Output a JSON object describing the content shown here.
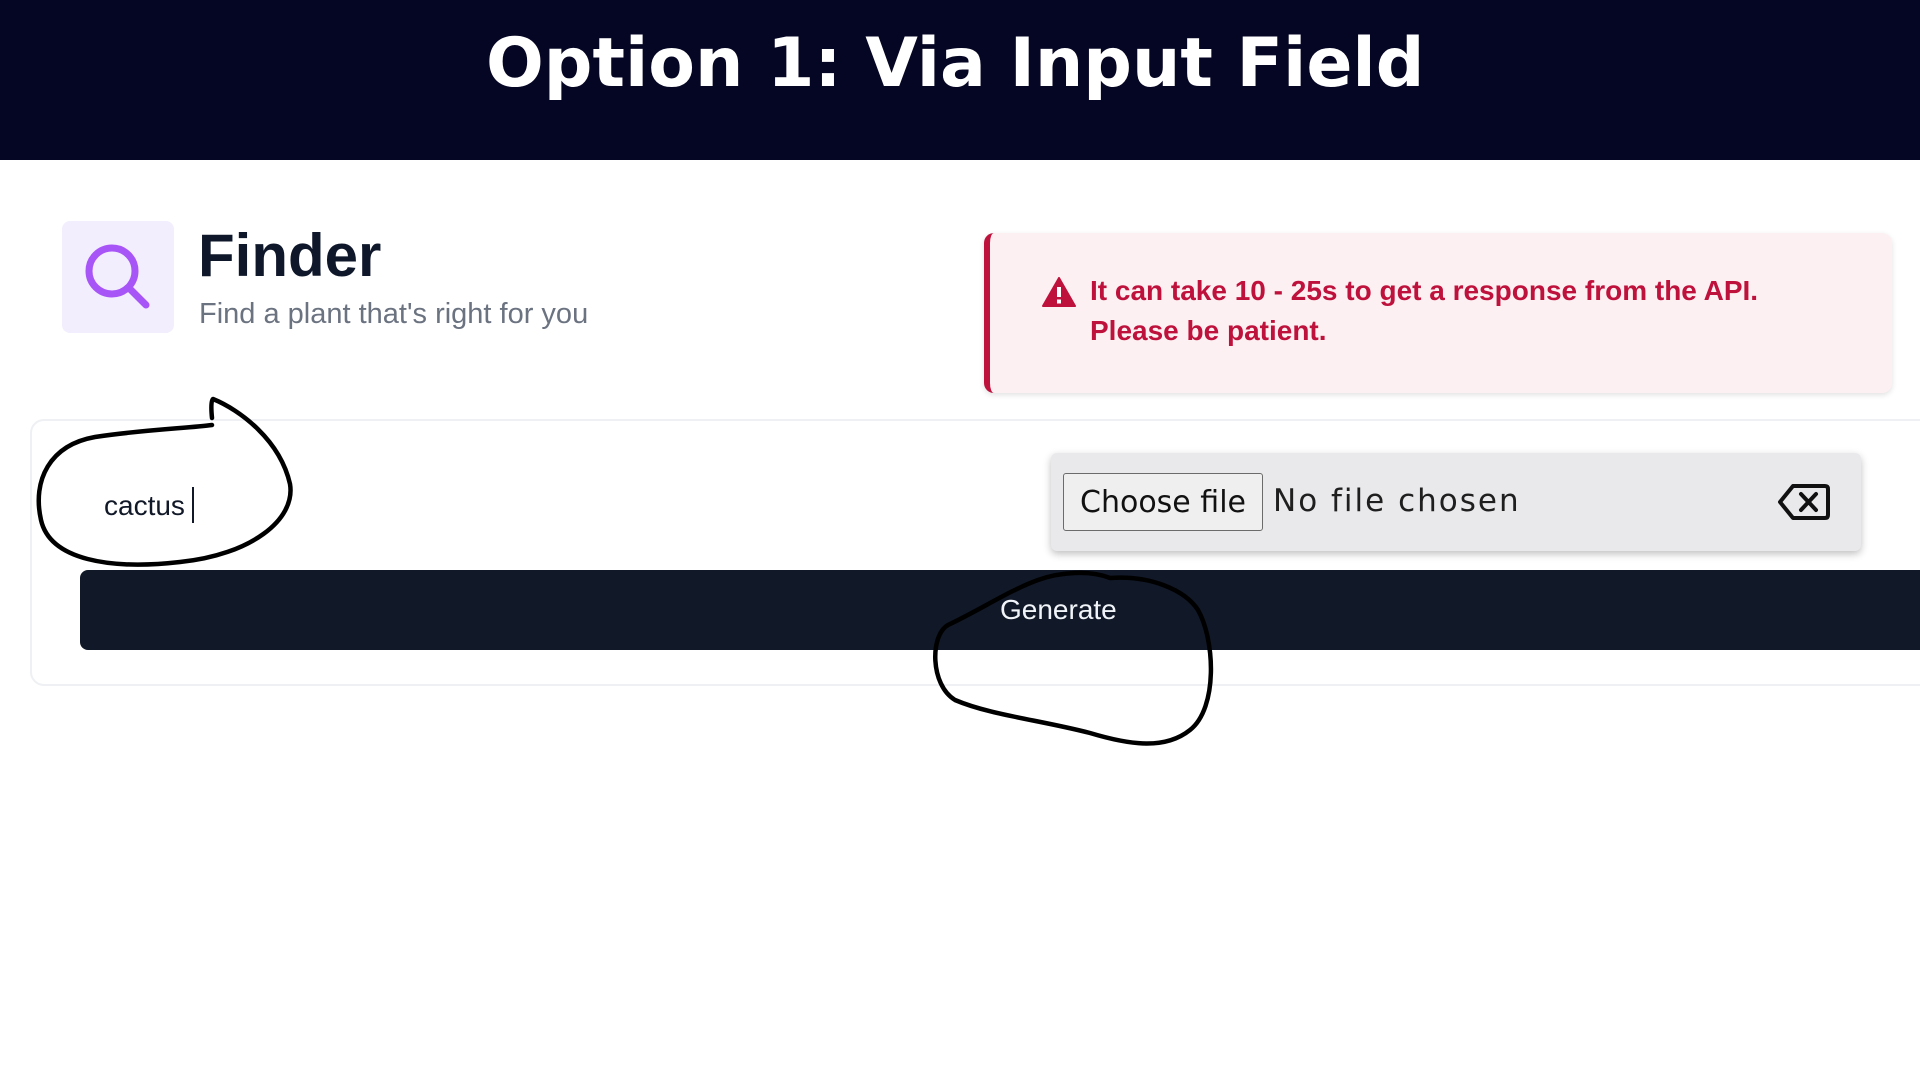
{
  "banner": {
    "title": "Option 1: Via Input Field"
  },
  "header": {
    "icon": "search-icon",
    "title": "Finder",
    "subtitle": "Find a plant that's right for you"
  },
  "alert": {
    "icon": "warning-icon",
    "message": "It can take 10 - 25s to get a response from the API. Please be patient.",
    "color": "#be123c"
  },
  "form": {
    "search_value": "cactus",
    "file_button_label": "Choose file",
    "file_status": "No file chosen",
    "clear_icon": "backspace-icon",
    "generate_label": "Generate"
  },
  "colors": {
    "banner_background": "#050524",
    "button_background": "#111827",
    "icon_accent": "#a855f7"
  }
}
